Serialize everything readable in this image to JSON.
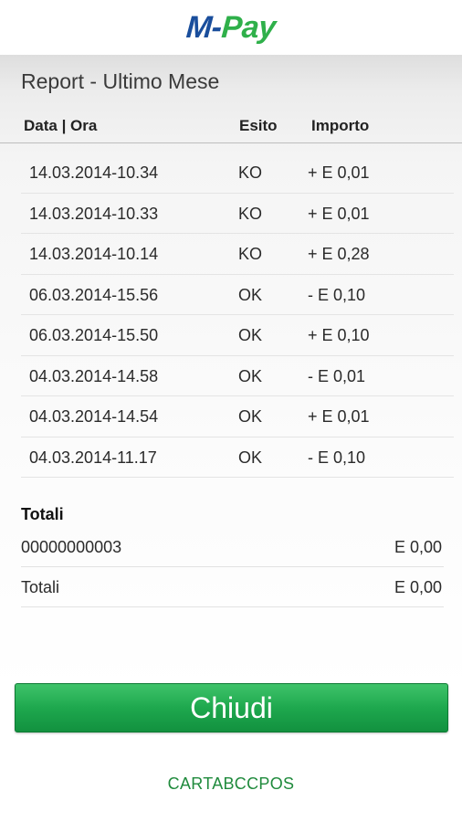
{
  "header": {
    "logo_m": "M",
    "logo_dash": "-",
    "logo_pay": "Pay"
  },
  "report": {
    "title": "Report - Ultimo Mese",
    "columns": [
      "Data | Ora",
      "Esito",
      "Importo"
    ],
    "rows": [
      {
        "date": "14.03.2014-10.34",
        "esito": "KO",
        "importo": "+ E 0,01"
      },
      {
        "date": "14.03.2014-10.33",
        "esito": "KO",
        "importo": "+ E 0,01"
      },
      {
        "date": "14.03.2014-10.14",
        "esito": "KO",
        "importo": "+ E 0,28"
      },
      {
        "date": "06.03.2014-15.56",
        "esito": "OK",
        "importo": "- E 0,10"
      },
      {
        "date": "06.03.2014-15.50",
        "esito": "OK",
        "importo": "+ E 0,10"
      },
      {
        "date": "04.03.2014-14.58",
        "esito": "OK",
        "importo": "- E 0,01"
      },
      {
        "date": "04.03.2014-14.54",
        "esito": "OK",
        "importo": "+ E 0,01"
      },
      {
        "date": "04.03.2014-11.17",
        "esito": "OK",
        "importo": "- E 0,10"
      }
    ]
  },
  "totals": {
    "title": "Totali",
    "lines": [
      {
        "label": "00000000003",
        "value": "E 0,00"
      },
      {
        "label": "Totali",
        "value": "E 0,00"
      }
    ]
  },
  "actions": {
    "close_label": "Chiudi"
  },
  "footer": {
    "text": "CARTABCCPOS"
  },
  "colors": {
    "brand_blue": "#1a4e9c",
    "brand_green": "#2fb04a",
    "button_green": "#1ea84e",
    "footer_green": "#1f8a3c"
  }
}
